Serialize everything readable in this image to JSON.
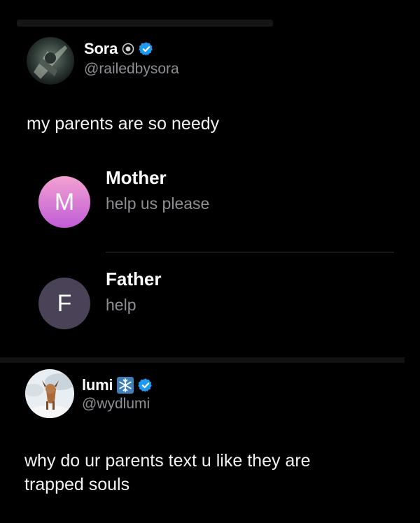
{
  "post1": {
    "author_name": "Sora",
    "handle": "@railedbysora",
    "text": "my parents are so needy",
    "contacts": [
      {
        "initial": "M",
        "name": "Mother",
        "message": "help us please"
      },
      {
        "initial": "F",
        "name": "Father",
        "message": "help"
      }
    ]
  },
  "post2": {
    "author_name": "lumi",
    "handle": "@wydlumi",
    "text_line1": "why do ur parents text u like they are",
    "text_line2": "trapped souls"
  },
  "colors": {
    "verified": "#1d9bf0",
    "mother_gradient_top": "#f3a2d2",
    "mother_gradient_bottom": "#c05cd6",
    "father_avatar": "#4a4358"
  }
}
